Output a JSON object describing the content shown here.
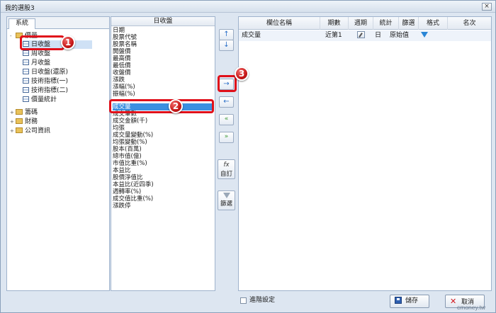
{
  "window": {
    "title": "我的選股3",
    "close_glyph": "×"
  },
  "tree": {
    "tab_label": "系統",
    "nodes": [
      {
        "label": "價量",
        "expand": "-"
      },
      {
        "label": "日收盤"
      },
      {
        "label": "周收盤"
      },
      {
        "label": "月收盤"
      },
      {
        "label": "日收盤(還原)"
      },
      {
        "label": "技術指標(一)"
      },
      {
        "label": "技術指標(二)"
      },
      {
        "label": "價量統計"
      },
      {
        "label": "籌碼",
        "expand": "+"
      },
      {
        "label": "財務",
        "expand": "+"
      },
      {
        "label": "公司資訊",
        "expand": "+"
      }
    ]
  },
  "fields": {
    "header": "日收盤",
    "items": [
      "日期",
      "股票代號",
      "股票名稱",
      "開盤價",
      "最高價",
      "最低價",
      "收盤價",
      "漲跌",
      "漲幅(%)",
      "振幅(%)",
      "成交量",
      "成交筆數",
      "成交金額(千)",
      "均張",
      "成交量變動(%)",
      "均張變動(%)",
      "股本(百萬)",
      "總市值(億)",
      "市值比重(%)",
      "本益比",
      "股價淨值比",
      "本益比(近四季)",
      "週轉率(%)",
      "成交值比重(%)",
      "漲跌停"
    ]
  },
  "buttons": {
    "move_up": "↑",
    "move_down": "↓",
    "add": "→",
    "remove": "←",
    "remove_all": "«",
    "add_all": "»",
    "custom_glyph": "fx",
    "custom_label": "自訂",
    "filter_label": "篩選"
  },
  "grid": {
    "columns": [
      "欄位名稱",
      "期數",
      "週期",
      "統計",
      "篩選",
      "格式",
      "名次"
    ],
    "rows": [
      {
        "name": "成交量",
        "period": "近第1",
        "cycle": "日",
        "stat": "原始值"
      }
    ]
  },
  "footer": {
    "advanced_label": "進階設定",
    "save_label": "儲存",
    "cancel_label": "取消",
    "cancel_glyph": "✕"
  },
  "annotations": [
    "1",
    "2",
    "3"
  ],
  "watermark": "cmoney.tw"
}
